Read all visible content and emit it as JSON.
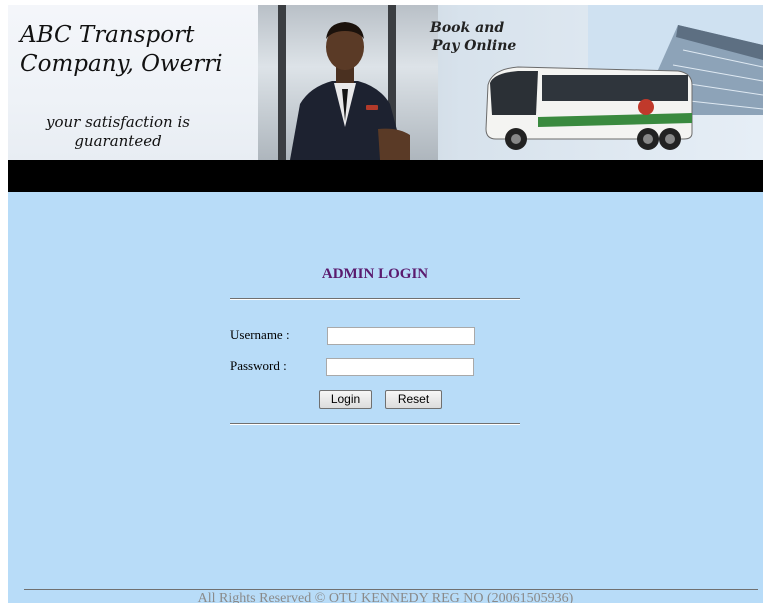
{
  "banner": {
    "company_name": "ABC Transport Company, Owerri",
    "company_name_line1": "ABC Transport",
    "company_name_line2": "Company, Owerri",
    "tagline_line1": "your satisfaction is",
    "tagline_line2": "guaranteed",
    "promo_line1": "Book and",
    "promo_line2": "Pay Online"
  },
  "login": {
    "title": "ADMIN LOGIN",
    "username_label": "Username :",
    "username_value": "",
    "password_label": "Password :",
    "password_value": "",
    "login_button": "Login",
    "reset_button": "Reset"
  },
  "footer": {
    "text": "All Rights Reserved © OTU KENNEDY REG NO (20061505936)"
  },
  "colors": {
    "content_background": "#b8dcf8",
    "nav_strip": "#000000",
    "login_title": "#5a1a6e",
    "footer_text": "#8a8a8a"
  }
}
